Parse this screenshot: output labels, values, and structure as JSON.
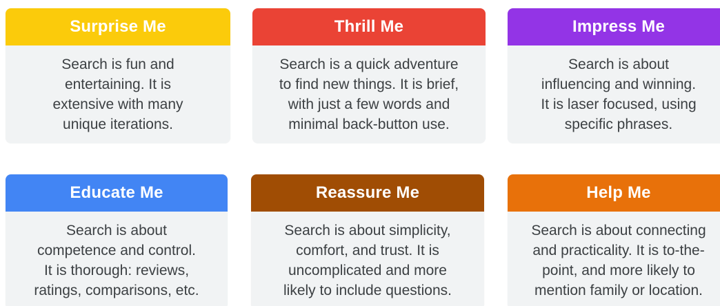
{
  "cards": [
    {
      "title": "Surprise Me",
      "text": "Search is fun and\nentertaining. It is\nextensive with many\nunique iterations.",
      "color": "#fbcb0b"
    },
    {
      "title": "Thrill Me",
      "text": "Search is a quick adventure\nto find new things. It is brief,\nwith just a few words and\nminimal back-button use.",
      "color": "#ea4335"
    },
    {
      "title": "Impress Me",
      "text": "Search is about\ninfluencing and winning.\nIt is laser focused, using\nspecific phrases.",
      "color": "#9334e6"
    },
    {
      "title": "Educate Me",
      "text": "Search is about\ncompetence and control.\nIt is thorough: reviews,\nratings, comparisons, etc.",
      "color": "#4285f4"
    },
    {
      "title": "Reassure Me",
      "text": "Search is about simplicity,\ncomfort, and trust. It is\nuncomplicated and more\nlikely to include questions.",
      "color": "#a04d04"
    },
    {
      "title": "Help Me",
      "text": "Search is about connecting\nand practicality. It is to-the-\npoint, and more likely to\nmention family or location.",
      "color": "#e8710a"
    }
  ]
}
